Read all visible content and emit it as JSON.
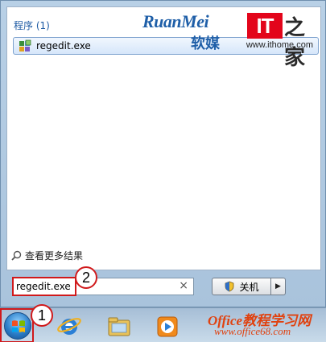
{
  "results": {
    "group_header": "程序 (1)",
    "item_label": "regedit.exe",
    "item_watermark": "www.ithome.com",
    "see_more": "查看更多结果"
  },
  "brand": {
    "latin": "RuanMei",
    "cjk": "软媒"
  },
  "it_logo": {
    "latin": "IT",
    "cjk": "之家"
  },
  "search": {
    "value": "regedit.exe",
    "clear": "×"
  },
  "shutdown": {
    "label": "关机",
    "arrow": "▶"
  },
  "callouts": {
    "step1": "1",
    "step2": "2"
  },
  "office_wm": {
    "top": "Office教程学习网",
    "bottom": "www.office68.com"
  },
  "colors": {
    "callout_red": "#d0191b",
    "header_blue": "#1d5aa3"
  }
}
